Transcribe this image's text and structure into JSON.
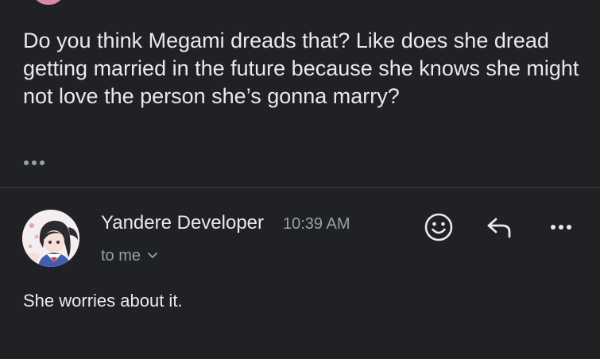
{
  "previous_message": {
    "body": "Do you think Megami dreads that? Like does she dread getting married in the future because she knows she might not love the person she’s gonna marry?",
    "show_quoted_icon": "more-horizontal-icon"
  },
  "message": {
    "sender": "Yandere Developer",
    "time": "10:39 AM",
    "recipient": "to me",
    "recipient_chevron_icon": "chevron-down-icon",
    "body": "She worries about it."
  },
  "actions": {
    "emoji_icon": "smiley-icon",
    "reply_icon": "reply-arrow-icon",
    "more_icon": "more-horizontal-icon"
  },
  "colors": {
    "background": "#202124",
    "text_primary": "#e8eaed",
    "text_secondary": "#9aa0a6",
    "divider": "#3c4043"
  }
}
